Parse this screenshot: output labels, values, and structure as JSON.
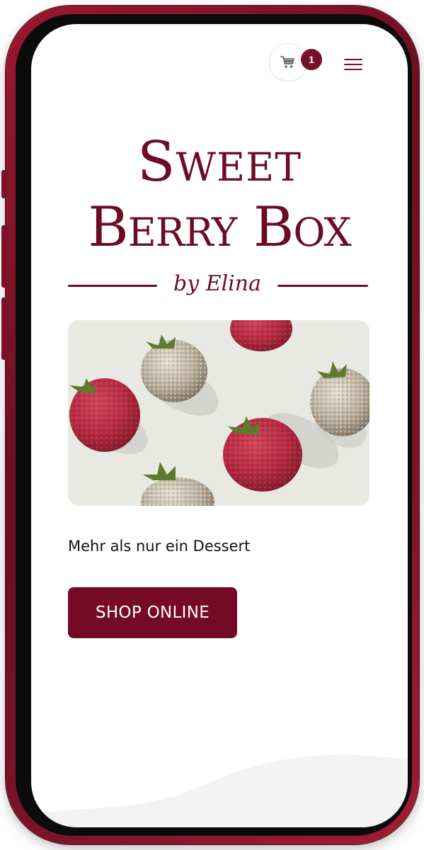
{
  "header": {
    "cart_count": "1",
    "cart_icon": "shopping-cart-icon",
    "menu_icon": "hamburger-menu-icon"
  },
  "brand": {
    "line1": "Sweet",
    "line2": "Berry Box",
    "byline": "by Elina",
    "color": "#6d0b24"
  },
  "hero": {
    "tagline": "Mehr als nur ein Dessert",
    "cta_label": "SHOP ONLINE",
    "cta_color": "#750a27"
  },
  "theme": {
    "frame_color": "#7d1428",
    "screen_background": "#ffffff"
  }
}
